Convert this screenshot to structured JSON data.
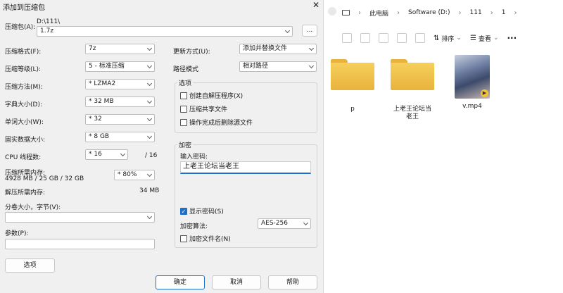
{
  "explorer": {
    "breadcrumb": [
      "此电脑",
      "Software (D:)",
      "111",
      "1"
    ],
    "toolbar": {
      "sort_label": "排序",
      "view_label": "查看",
      "more_label": "···"
    },
    "files": [
      {
        "name": "p",
        "type": "folder"
      },
      {
        "name": "上老王论坛当老王",
        "type": "folder"
      },
      {
        "name": "v.mp4",
        "type": "video"
      }
    ]
  },
  "dialog": {
    "title": "添加到压缩包",
    "close_glyph": "✕",
    "archive": {
      "label": "压缩包(A):",
      "path": "D:\\111\\",
      "value": "1.7z",
      "browse_label": "..."
    },
    "left_fields": [
      {
        "label": "压缩格式(F):",
        "value": "7z"
      },
      {
        "label": "压缩等级(L):",
        "value": "5 - 标准压缩"
      },
      {
        "label": "压缩方法(M):",
        "value": "* LZMA2"
      },
      {
        "label": "字典大小(D):",
        "value": "* 32 MB"
      },
      {
        "label": "单词大小(W):",
        "value": "* 32"
      },
      {
        "label": "固实数据大小:",
        "value": "* 8 GB"
      }
    ],
    "cpu": {
      "label": "CPU 线程数:",
      "value": "* 16",
      "total": "/ 16"
    },
    "memory": {
      "label": "压缩所需内存:",
      "detail": "4928 MB / 25 GB / 32 GB",
      "value": "* 80%"
    },
    "decompress_memory": {
      "label": "解压所需内存:",
      "value": "34 MB"
    },
    "split": {
      "label": "分卷大小，字节(V):",
      "value": ""
    },
    "params": {
      "label": "参数(P):",
      "value": ""
    },
    "options_button": "选项",
    "update": {
      "label": "更新方式(U):",
      "value": "添加并替换文件"
    },
    "path_mode": {
      "label": "路径模式",
      "value": "相对路径"
    },
    "options_group": {
      "title": "选项",
      "items": [
        {
          "label": "创建自解压程序(X)",
          "checked": false
        },
        {
          "label": "压缩共享文件",
          "checked": false
        },
        {
          "label": "操作完成后删除源文件",
          "checked": false
        }
      ]
    },
    "encryption": {
      "title": "加密",
      "password_label": "输入密码:",
      "password_value": "上老王论坛当老王",
      "show_password": {
        "label": "显示密码(S)",
        "checked": true
      },
      "method_label": "加密算法:",
      "method_value": "AES-256",
      "encrypt_names": {
        "label": "加密文件名(N)",
        "checked": false
      }
    },
    "buttons": {
      "ok": "确定",
      "cancel": "取消",
      "help": "帮助"
    },
    "check_glyph": "✓"
  }
}
